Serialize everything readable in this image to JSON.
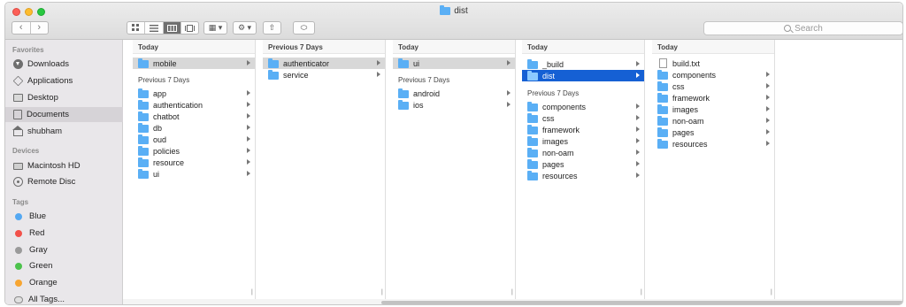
{
  "window": {
    "title": "dist"
  },
  "toolbar": {
    "back": "‹",
    "forward": "›",
    "view_icons": [
      "icon-view-icon",
      "list-view-icon",
      "column-view-icon",
      "gallery-view-icon"
    ],
    "arrange_glyph": "▦ ▾",
    "action_glyph": "⚙ ▾",
    "share_glyph": "⇧",
    "tag_glyph": "⬭",
    "search_placeholder": "Search"
  },
  "sidebar": {
    "favorites_header": "Favorites",
    "favorites": [
      {
        "label": "Downloads",
        "icon": "download-icon"
      },
      {
        "label": "Applications",
        "icon": "applications-icon"
      },
      {
        "label": "Desktop",
        "icon": "desktop-icon"
      },
      {
        "label": "Documents",
        "icon": "documents-icon",
        "selected": true
      },
      {
        "label": "shubham",
        "icon": "home-icon"
      }
    ],
    "devices_header": "Devices",
    "devices": [
      {
        "label": "Macintosh HD",
        "icon": "hard-drive-icon"
      },
      {
        "label": "Remote Disc",
        "icon": "disc-icon"
      }
    ],
    "tags_header": "Tags",
    "tags": [
      {
        "label": "Blue",
        "color": "#54a8f2"
      },
      {
        "label": "Red",
        "color": "#f2514a"
      },
      {
        "label": "Gray",
        "color": "#9a9a9a"
      },
      {
        "label": "Green",
        "color": "#4cc24c"
      },
      {
        "label": "Orange",
        "color": "#f7a531"
      }
    ],
    "all_tags": "All Tags..."
  },
  "columns": [
    {
      "today_header": "Today",
      "today": [
        {
          "name": "mobile",
          "type": "folder",
          "selected": "gray"
        }
      ],
      "prev_header": "Previous 7 Days",
      "prev": [
        {
          "name": "app",
          "type": "folder"
        },
        {
          "name": "authentication",
          "type": "folder"
        },
        {
          "name": "chatbot",
          "type": "folder"
        },
        {
          "name": "db",
          "type": "folder"
        },
        {
          "name": "oud",
          "type": "folder"
        },
        {
          "name": "policies",
          "type": "folder"
        },
        {
          "name": "resource",
          "type": "folder"
        },
        {
          "name": "ui",
          "type": "folder"
        }
      ]
    },
    {
      "today_header": "Previous 7 Days",
      "today": [
        {
          "name": "authenticator",
          "type": "folder",
          "selected": "gray"
        },
        {
          "name": "service",
          "type": "folder"
        }
      ]
    },
    {
      "today_header": "Today",
      "today": [
        {
          "name": "ui",
          "type": "folder",
          "selected": "gray"
        }
      ],
      "prev_header": "Previous 7 Days",
      "prev": [
        {
          "name": "android",
          "type": "folder"
        },
        {
          "name": "ios",
          "type": "folder"
        }
      ]
    },
    {
      "today_header": "Today",
      "today": [
        {
          "name": "_build",
          "type": "folder"
        },
        {
          "name": "dist",
          "type": "folder",
          "selected": "blue"
        }
      ],
      "prev_header": "Previous 7 Days",
      "prev": [
        {
          "name": "components",
          "type": "folder"
        },
        {
          "name": "css",
          "type": "folder"
        },
        {
          "name": "framework",
          "type": "folder"
        },
        {
          "name": "images",
          "type": "folder"
        },
        {
          "name": "non-oam",
          "type": "folder"
        },
        {
          "name": "pages",
          "type": "folder"
        },
        {
          "name": "resources",
          "type": "folder"
        }
      ]
    },
    {
      "today_header": "Today",
      "today": [
        {
          "name": "build.txt",
          "type": "file"
        },
        {
          "name": "components",
          "type": "folder"
        },
        {
          "name": "css",
          "type": "folder"
        },
        {
          "name": "framework",
          "type": "folder"
        },
        {
          "name": "images",
          "type": "folder"
        },
        {
          "name": "non-oam",
          "type": "folder"
        },
        {
          "name": "pages",
          "type": "folder"
        },
        {
          "name": "resources",
          "type": "folder"
        }
      ]
    }
  ],
  "colors": {
    "selection_blue": "#1560d4",
    "folder_blue": "#5aaff5",
    "sidebar_bg": "#e9e7ea"
  }
}
